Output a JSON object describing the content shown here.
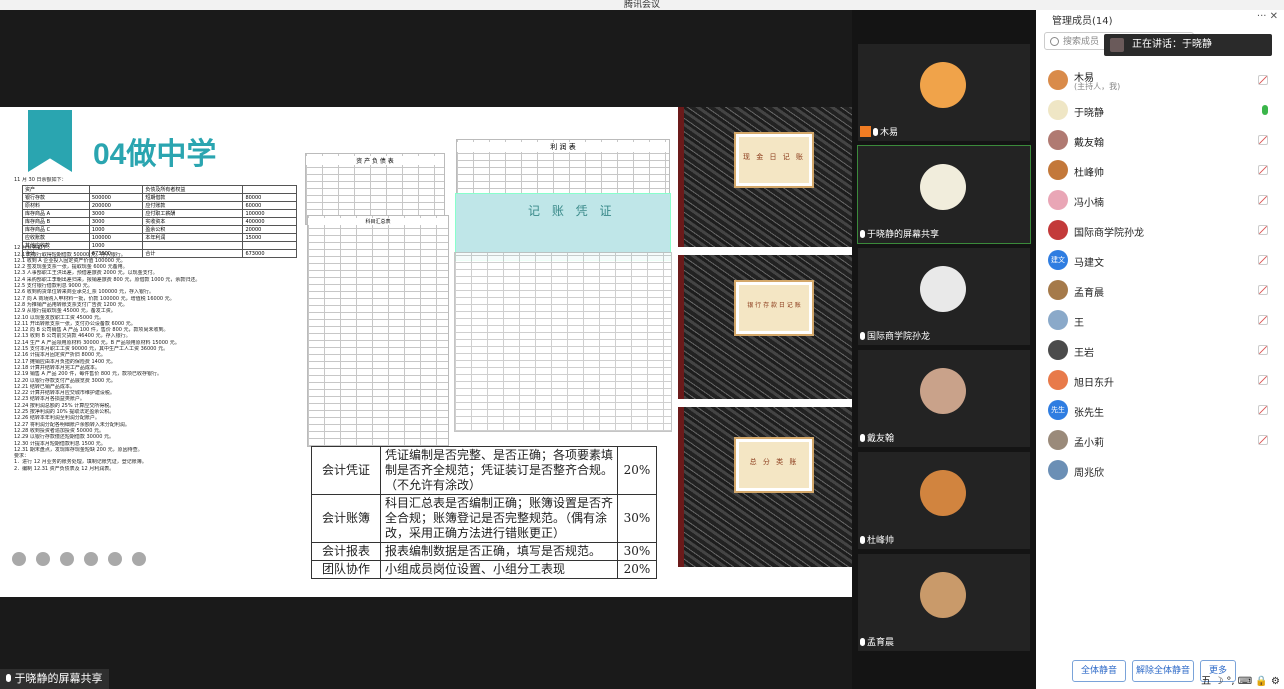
{
  "window": {
    "title": "腾讯会议"
  },
  "slide": {
    "title": "04做中学",
    "doc_lines": [
      "11 月 30 日余额如下：",
      "12 月业务如下：",
      "12.1 向银行取得短期借款 50000 元，存入银行。",
      "12.1 收到 A 企业投入固定资产价值 100000 元。",
      "12.2 签发现金支票一张，提取现金 6000 元备用。",
      "12.3 人事部职工王洪出差，预借差旅费 2000 元，以现金支付。",
      "12.4 采购部职工李朝出差归来，报销差旅费 800 元，原借款 1000 元，余款归还。",
      "12.5 支付银行借款利息 9000 元。",
      "12.6 收到购货单位转来商业承兑汇票 100000 元，存入银行。",
      "12.7 向 A 商场购入甲材料一批，价款 100000 元，增值税 16000 元。",
      "12.8 为推销产品用转账支票支付广告费 1200 元。",
      "12.9 从银行提取现金 45000 元，备发工资。",
      "12.10 以现金发放职工工资 45000 元。",
      "12.11 开出转账支票一张，支付办公设备款 6000 元。",
      "12.12 向 B 公司销售 A 产品 100 件，售价 800 元，款项尚未收到。",
      "12.13 收到 B 公司前欠货款 46400 元，存入银行。",
      "12.14 生产 A 产品领用原材料 30000 元，B 产品领用原材料 15000 元。",
      "12.15 支付本月职工工资 90000 元，其中生产工人工资 36000 元。",
      "12.16 计提本月固定资产折旧 8000 元。",
      "12.17 摊销应由本月负担的保险费 1400 元。",
      "12.18 计算并结转本月完工产品成本。",
      "12.19 销售 A 产品 200 件，每件售价 800 元，款项已收存银行。",
      "12.20 以银行存款支付产品展览费 3000 元。",
      "12.21 结转已销产品成本。",
      "12.22 计算并结转本月应交城市维护建设税。",
      "12.23 结转本月各损益类账户。",
      "12.24 按利润总额的 25% 计算应交所得税。",
      "12.25 按净利润的 10% 提取法定盈余公积。",
      "12.26 结转本年利润至利润分配账户。",
      "12.27 将利润分配各明细账户余额转入未分配利润。",
      "12.28 收到投资者追加投资 50000 元。",
      "12.29 以银行存款偿还短期借款 30000 元。",
      "12.30 计提本月短期借款利息 1500 元。",
      "12.31 期末盘点，发现库存现金短缺 200 元，原因待查。",
      "要求：",
      "1．进行 12 月业务的账务处理，填制记账凭证，登记账簿。",
      "2．编制 12.31 资产负债表及 12 月利润表。"
    ],
    "balance_table": {
      "headers": [
        "资产",
        "",
        "负债及所有者权益",
        ""
      ],
      "rows": [
        [
          "银行存款",
          "500000",
          "短期借款",
          "80000"
        ],
        [
          "原材料",
          "200000",
          "应付账款",
          "60000"
        ],
        [
          "库存商品 A",
          "3000",
          "应付职工薪酬",
          "100000"
        ],
        [
          "库存商品 B",
          "3000",
          "实收资本",
          "400000"
        ],
        [
          "库存商品 C",
          "1000",
          "盈余公积",
          "20000"
        ],
        [
          "应收账款",
          "100000",
          "本年利润",
          "15000"
        ],
        [
          "其他应收款",
          "1000",
          "",
          ""
        ],
        [
          "合计",
          "673000",
          "合计",
          "673000"
        ]
      ]
    },
    "balance_sheet_title": "资 产 负 债 表",
    "income_sheet_title": "利 润 表",
    "ledger_sheet_title": "科目汇总表",
    "voucher_title": "记 账 凭 证",
    "books": [
      "现 金 日 记 账",
      "银 行 存 款 日 记 账",
      "总 分 类 账"
    ],
    "score_rows": [
      {
        "item": "会计凭证",
        "desc": "凭证编制是否完整、是否正确；各项要素填制是否齐全规范；凭证装订是否整齐合规。（不允许有涂改）",
        "pct": "20%"
      },
      {
        "item": "会计账簿",
        "desc": "科目汇总表是否编制正确；账簿设置是否齐全合规；账簿登记是否完整规范。（偶有涂改，采用正确方法进行错账更正）",
        "pct": "30%"
      },
      {
        "item": "会计报表",
        "desc": "报表编制数据是否正确，填写是否规范。",
        "pct": "30%"
      },
      {
        "item": "团队协作",
        "desc": "小组成员岗位设置、小组分工表现",
        "pct": "20%"
      }
    ]
  },
  "share_label": "于晓静的屏幕共享",
  "video_tiles": [
    {
      "name": "木易",
      "host": true,
      "avatar_color": "#f0a34a"
    },
    {
      "name": "于晓静的屏幕共享",
      "host": false,
      "avatar_color": "#f1eddc"
    },
    {
      "name": "国际商学院孙龙",
      "host": false,
      "avatar_color": "#e9e9e9"
    },
    {
      "name": "戴友翰",
      "host": false,
      "avatar_color": "#c9a28a"
    },
    {
      "name": "杜峰帅",
      "host": false,
      "avatar_color": "#d1843f"
    },
    {
      "name": "孟育晨",
      "host": false,
      "avatar_color": "#c99a6a"
    }
  ],
  "panel": {
    "title": "管理成员(14)",
    "controls": "··· ✕",
    "search_placeholder": "搜索成员",
    "speaking_prefix": "正在讲话：",
    "speaking_name": "于晓静",
    "members": [
      {
        "name": "木易",
        "sub": "(主持人，我)",
        "color": "#d98b4a",
        "muted": true
      },
      {
        "name": "于晓静",
        "sub": "",
        "color": "#efe6c5",
        "muted": false
      },
      {
        "name": "戴友翰",
        "sub": "",
        "color": "#b07a72",
        "muted": true
      },
      {
        "name": "杜峰帅",
        "sub": "",
        "color": "#c3783a",
        "muted": true
      },
      {
        "name": "冯小楠",
        "sub": "",
        "color": "#e9a6b6",
        "muted": true
      },
      {
        "name": "国际商学院孙龙",
        "sub": "",
        "color": "#c33a3a",
        "muted": true
      },
      {
        "name": "马建文",
        "sub": "",
        "color": "#2f7de1",
        "muted": true,
        "badge": "建文"
      },
      {
        "name": "孟育晨",
        "sub": "",
        "color": "#a57a4a",
        "muted": true
      },
      {
        "name": "王",
        "sub": "",
        "color": "#8aa9c9",
        "muted": true
      },
      {
        "name": "王岩",
        "sub": "",
        "color": "#4b4b4b",
        "muted": true
      },
      {
        "name": "旭日东升",
        "sub": "",
        "color": "#e87a4a",
        "muted": true
      },
      {
        "name": "张先生",
        "sub": "",
        "color": "#2f7de1",
        "muted": true,
        "badge": "先生"
      },
      {
        "name": "孟小莉",
        "sub": "",
        "color": "#9a8a7a",
        "muted": true
      },
      {
        "name": "周兆欣",
        "sub": "",
        "color": "#6b8fb5",
        "muted": false
      }
    ],
    "mute_all": "全体静音",
    "unmute_all": "解除全体静音",
    "more": "更多"
  },
  "tray": {
    "text": "五 ☽ °, ⌨ 🔒 ⚙"
  }
}
